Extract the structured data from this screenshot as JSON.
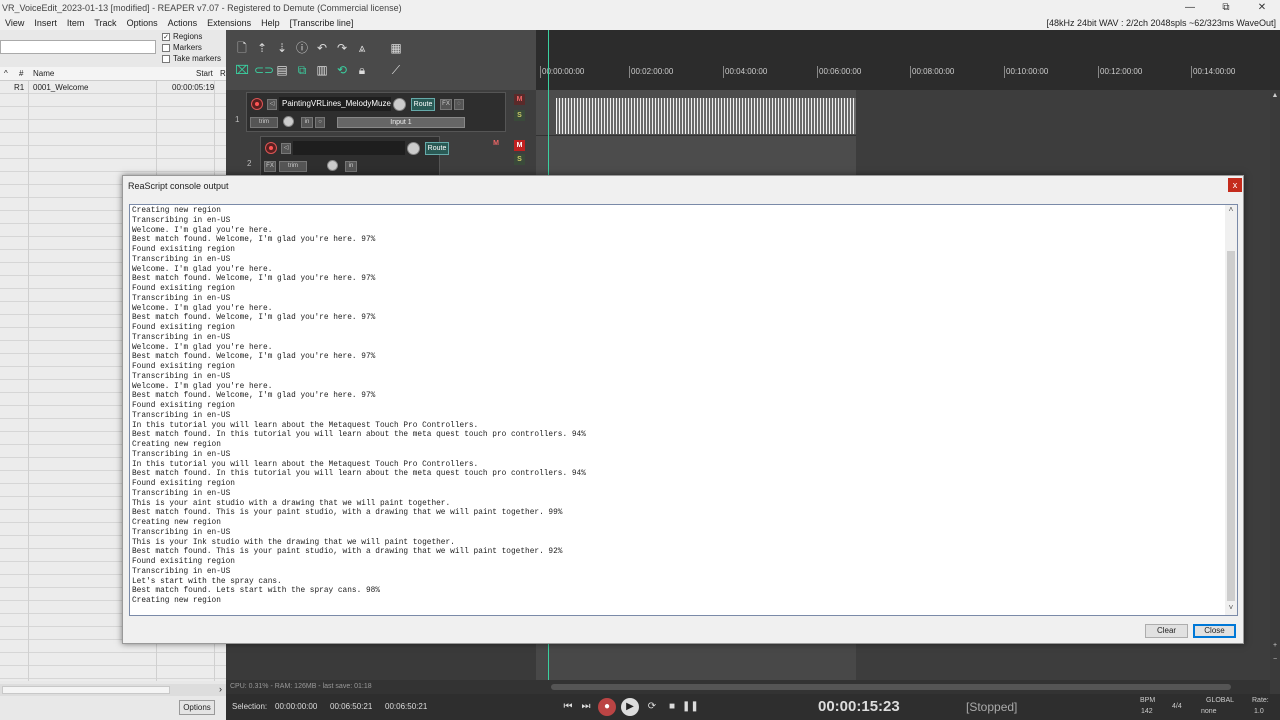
{
  "window": {
    "title": "VR_VoiceEdit_2023-01-13 [modified] - REAPER v7.07 - Registered to Demute (Commercial license)",
    "min": "—",
    "restore": "⧉",
    "close": "✕"
  },
  "menu": {
    "items": [
      "View",
      "Insert",
      "Item",
      "Track",
      "Options",
      "Actions",
      "Extensions",
      "Help",
      "[Transcribe line]"
    ],
    "audio_status": "[48kHz 24bit WAV : 2/2ch 2048spls ~62/323ms WaveOut]"
  },
  "region_manager": {
    "checkboxes": [
      {
        "label": "Regions",
        "checked": true
      },
      {
        "label": "Markers",
        "checked": false
      },
      {
        "label": "Take markers",
        "checked": false
      }
    ],
    "headers": {
      "num": "#",
      "name": "Name",
      "start": "Start",
      "r": "R"
    },
    "rows": [
      {
        "id": "R1",
        "name": "0001_Welcome",
        "start": "00:00:05:19"
      }
    ],
    "options_label": "Options",
    "scroll_arrow": "›"
  },
  "tracks": [
    {
      "number": "1",
      "name": "PaintingVRLines_MelodyMuze",
      "route": "Route",
      "fx": "FX",
      "trim": "trim",
      "in": "in",
      "input": "Input 1",
      "m": "M",
      "s": "S"
    },
    {
      "number": "2",
      "name": "",
      "route": "Route",
      "fx": "FX",
      "trim": "trim",
      "in": "in",
      "m": "M",
      "s": "S"
    }
  ],
  "ruler": {
    "marks": [
      "00:00:00:00",
      "00:02:00:00",
      "00:04:00:00",
      "00:06:00:00",
      "00:08:00:00",
      "00:10:00:00",
      "00:12:00:00",
      "00:14:00:00"
    ]
  },
  "console": {
    "title": "ReaScript console output",
    "close": "x",
    "lines": [
      "Creating new region",
      "Transcribing in en-US",
      "Welcome. I'm glad you're here.",
      "Best match found. Welcome, I'm glad you're here. 97%",
      "Found exisiting region",
      "Transcribing in en-US",
      "Welcome. I'm glad you're here.",
      "Best match found. Welcome, I'm glad you're here. 97%",
      "Found exisiting region",
      "Transcribing in en-US",
      "Welcome. I'm glad you're here.",
      "Best match found. Welcome, I'm glad you're here. 97%",
      "Found exisiting region",
      "Transcribing in en-US",
      "Welcome. I'm glad you're here.",
      "Best match found. Welcome, I'm glad you're here. 97%",
      "Found exisiting region",
      "Transcribing in en-US",
      "Welcome. I'm glad you're here.",
      "Best match found. Welcome, I'm glad you're here. 97%",
      "Found exisiting region",
      "Transcribing in en-US",
      "In this tutorial you will learn about the Metaquest Touch Pro Controllers.",
      "Best match found. In this tutorial you will learn about the meta quest touch pro controllers. 94%",
      "Creating new region",
      "Transcribing in en-US",
      "In this tutorial you will learn about the Metaquest Touch Pro Controllers.",
      "Best match found. In this tutorial you will learn about the meta quest touch pro controllers. 94%",
      "Found exisiting region",
      "Transcribing in en-US",
      "This is your aint studio with a drawing that we will paint together.",
      "Best match found. This is your paint studio, with a drawing that we will paint together. 99%",
      "Creating new region",
      "Transcribing in en-US",
      "This is your Ink studio with the drawing that we will paint together.",
      "Best match found. This is your paint studio, with a drawing that we will paint together. 92%",
      "Found exisiting region",
      "Transcribing in en-US",
      "Let's start with the spray cans.",
      "Best match found. Lets start with the spray cans. 98%",
      "Creating new region"
    ],
    "clear_label": "Clear",
    "close_label": "Close"
  },
  "status": {
    "cpu": "CPU: 0.31% - RAM: 126MB - last save: 01:18"
  },
  "transport": {
    "selection_label": "Selection:",
    "sel_start": "00:00:00:00",
    "sel_end": "00:06:50:21",
    "sel_length": "00:06:50:21",
    "timecode": "00:00:15:23",
    "state": "[Stopped]",
    "bpm_label": "BPM",
    "bpm_value": "142",
    "timesig": "4/4",
    "global_label": "GLOBAL",
    "global_value": "none",
    "rate_label": "Rate:",
    "rate_value": "1.0"
  },
  "colors": {
    "accent": "#3ad0a0",
    "mute_active": "#c02020",
    "close_red": "#c42b1c"
  }
}
